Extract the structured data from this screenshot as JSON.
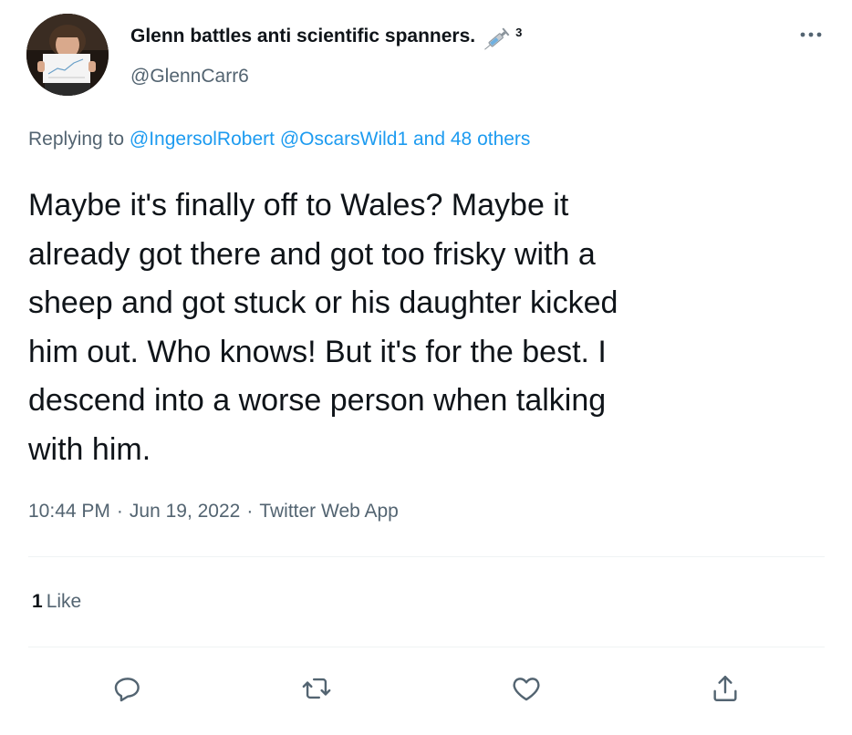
{
  "author": {
    "display_name": "Glenn battles anti scientific spanners.",
    "emoji_icon": "syringe-icon",
    "superscript": "3",
    "handle": "@GlennCarr6"
  },
  "reply": {
    "prefix": "Replying to",
    "mention_1": "@IngersolRobert",
    "mention_2": "@OscarsWild1",
    "others": "and 48 others"
  },
  "tweet": {
    "lines": [
      "Maybe it's finally off to Wales? Maybe it",
      "already got there and got too frisky with a",
      "sheep and got stuck or his daughter kicked",
      "him out. Who knows! But it's for the best. I",
      "descend into a worse person when talking",
      "with him."
    ]
  },
  "meta": {
    "time": "10:44 PM",
    "date": "Jun 19, 2022",
    "source": "Twitter Web App",
    "separator": "·"
  },
  "engagement": {
    "like_count": "1",
    "like_label": "Like"
  },
  "icons": {
    "more": "more-icon",
    "reply": "reply-icon",
    "retweet": "retweet-icon",
    "like": "heart-icon",
    "share": "share-icon"
  },
  "colors": {
    "link": "#1d9bf0",
    "secondary_text": "#536471",
    "primary_text": "#0f1419",
    "divider": "#eff3f4"
  }
}
